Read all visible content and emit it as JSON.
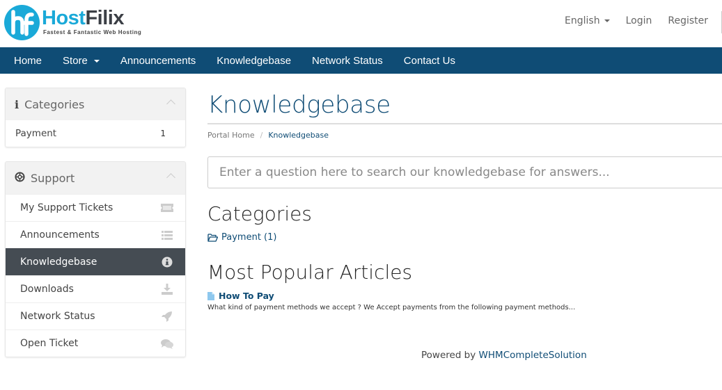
{
  "header": {
    "logo": {
      "brand_part1": "Host",
      "brand_part2": "Filix",
      "tagline": "Fastest & Fantastic Web Hosting",
      "mark": "hf"
    },
    "language": "English",
    "login": "Login",
    "register": "Register"
  },
  "nav": {
    "items": [
      {
        "label": "Home"
      },
      {
        "label": "Store",
        "has_dropdown": true
      },
      {
        "label": "Announcements"
      },
      {
        "label": "Knowledgebase"
      },
      {
        "label": "Network Status"
      },
      {
        "label": "Contact Us"
      }
    ]
  },
  "sidebar": {
    "categories_panel": {
      "title": "Categories",
      "icon": "info-icon",
      "items": [
        {
          "label": "Payment",
          "count": "1"
        }
      ]
    },
    "support_panel": {
      "title": "Support",
      "icon": "life-ring-icon",
      "items": [
        {
          "label": "My Support Tickets",
          "icon": "ticket-icon"
        },
        {
          "label": "Announcements",
          "icon": "list-icon"
        },
        {
          "label": "Knowledgebase",
          "icon": "info-circle-icon",
          "active": true
        },
        {
          "label": "Downloads",
          "icon": "download-icon"
        },
        {
          "label": "Network Status",
          "icon": "rocket-icon"
        },
        {
          "label": "Open Ticket",
          "icon": "comments-icon"
        }
      ]
    }
  },
  "main": {
    "title": "Knowledgebase",
    "breadcrumb": [
      {
        "label": "Portal Home"
      },
      {
        "label": "Knowledgebase"
      }
    ],
    "search_placeholder": "Enter a question here to search our knowledgebase for answers...",
    "categories_heading": "Categories",
    "categories": [
      {
        "label": "Payment (1)"
      }
    ],
    "popular_heading": "Most Popular Articles",
    "articles": [
      {
        "title": "How To Pay",
        "excerpt": "What kind of payment methods we accept ? We Accept payments from the following payment methods..."
      }
    ]
  },
  "footer": {
    "prefix": "Powered by ",
    "brand": "WHMCompleteSolution"
  },
  "colors": {
    "primary": "#0f4c75",
    "logo_blue": "#1aa9d8",
    "active_item": "#454c53"
  }
}
